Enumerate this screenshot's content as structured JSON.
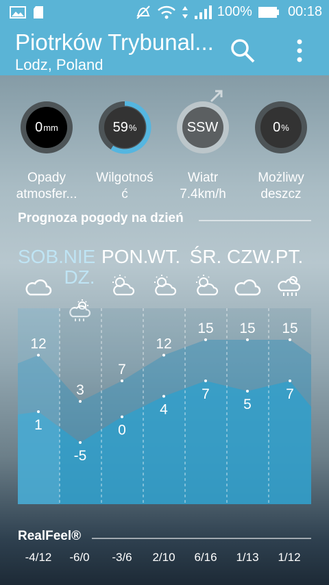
{
  "status_bar": {
    "battery": "100%",
    "time": "00:18"
  },
  "header": {
    "title": "Piotrków Trybunal...",
    "subtitle": "Lodz, Poland"
  },
  "conditions": [
    {
      "value": "0",
      "unit": "mm",
      "label": "Opady atmosfer...",
      "fill": 0
    },
    {
      "value": "59",
      "unit": "%",
      "label": "Wilgotność",
      "fill": 0.59
    },
    {
      "value": "SSW",
      "unit": "",
      "label": "Wiatr 7.4km/h",
      "fill": 0
    },
    {
      "value": "0",
      "unit": "%",
      "label": "Możliwy deszcz",
      "fill": 0
    }
  ],
  "forecast_title": "Prognoza pogody na dzień",
  "days": [
    {
      "name": "SOB.",
      "icon": "cloud-icon",
      "active": true
    },
    {
      "name": "NIEDZ.",
      "icon": "sun-cloud-rain-icon",
      "active": true
    },
    {
      "name": "PON.",
      "icon": "sun-cloud-icon",
      "active": false
    },
    {
      "name": "WT.",
      "icon": "sun-cloud-icon",
      "active": false
    },
    {
      "name": "ŚR.",
      "icon": "sun-cloud-icon",
      "active": false
    },
    {
      "name": "CZW.",
      "icon": "cloud-icon",
      "active": false
    },
    {
      "name": "PT.",
      "icon": "rain-cloud-icon",
      "active": false
    }
  ],
  "chart_data": {
    "type": "area",
    "categories": [
      "SOB.",
      "NIEDZ.",
      "PON.",
      "WT.",
      "ŚR.",
      "CZW.",
      "PT."
    ],
    "series": [
      {
        "values": [
          12,
          3,
          7,
          12,
          15,
          15,
          15
        ]
      },
      {
        "values": [
          1,
          -5,
          0,
          4,
          7,
          5,
          7
        ]
      }
    ]
  },
  "realfeel_title": "RealFeel®",
  "realfeel": [
    "-4/12",
    "-6/0",
    "-3/6",
    "2/10",
    "6/16",
    "1/13",
    "1/12"
  ]
}
